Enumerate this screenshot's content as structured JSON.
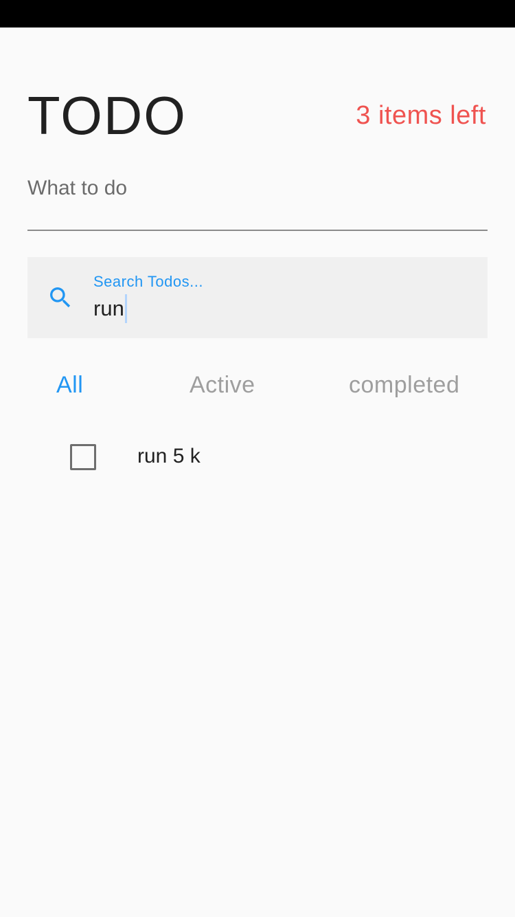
{
  "header": {
    "title": "TODO",
    "items_left": "3 items left"
  },
  "new_todo": {
    "placeholder": "What to do",
    "value": ""
  },
  "search": {
    "label": "Search Todos...",
    "value": "run",
    "icon": "search-icon"
  },
  "tabs": [
    {
      "label": "All",
      "selected": true
    },
    {
      "label": "Active",
      "selected": false
    },
    {
      "label": "completed",
      "selected": false
    }
  ],
  "todos": [
    {
      "text": "run 5 k",
      "completed": false
    }
  ],
  "colors": {
    "accent": "#2196f3",
    "items_left": "#ef5350",
    "background": "#fafafa",
    "search_background": "#f0f0f0",
    "inactive_tab": "#9e9e9e"
  }
}
